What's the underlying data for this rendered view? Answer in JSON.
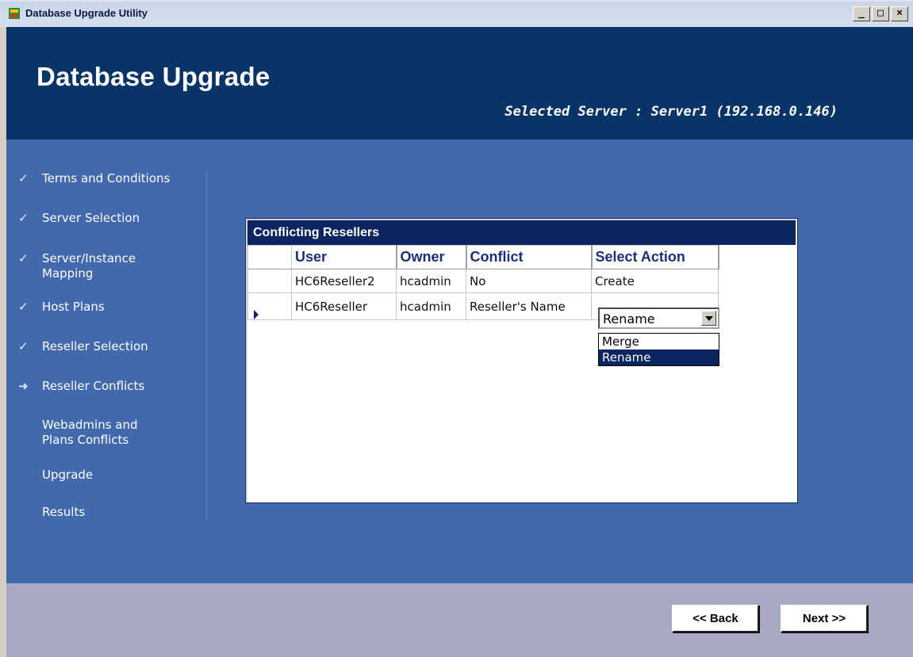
{
  "window": {
    "title": "Database Upgrade Utility",
    "controls": {
      "minimize": "_",
      "maximize": "□",
      "close": "×"
    }
  },
  "header": {
    "title": "Database Upgrade",
    "server_text": "Selected Server : Server1 (192.168.0.146)"
  },
  "nav": {
    "items": [
      {
        "label": "Terms and Conditions",
        "mark": "✓",
        "state": "done"
      },
      {
        "label": "Server Selection",
        "mark": "✓",
        "state": "done"
      },
      {
        "label": "Server/Instance Mapping",
        "mark": "✓",
        "state": "done"
      },
      {
        "label": "Host Plans",
        "mark": "✓",
        "state": "done"
      },
      {
        "label": "Reseller Selection",
        "mark": "✓",
        "state": "done"
      },
      {
        "label": "Reseller Conflicts",
        "mark": "➜",
        "state": "current"
      },
      {
        "label": "Webadmins and Plans Conflicts",
        "mark": "",
        "state": "pending"
      },
      {
        "label": "Upgrade",
        "mark": "",
        "state": "pending"
      },
      {
        "label": "Results",
        "mark": "",
        "state": "pending"
      }
    ]
  },
  "grid": {
    "caption": "Conflicting Resellers",
    "columns": [
      "User",
      "Owner",
      "Conflict",
      "Select Action"
    ],
    "rows": [
      {
        "user": "HC6Reseller2",
        "owner": "hcadmin",
        "conflict": "No",
        "action": "Create"
      },
      {
        "user": "HC6Reseller",
        "owner": "hcadmin",
        "conflict": "Reseller's Name",
        "action": "Rename"
      }
    ],
    "dropdown": {
      "selected": "Rename",
      "options": [
        "Merge",
        "Rename"
      ],
      "highlighted": "Rename"
    }
  },
  "footer": {
    "back_label": "<< Back",
    "next_label": "Next >>"
  },
  "colors": {
    "header_bg": "#093467",
    "body_bg": "#4268ae",
    "caption_bg": "#0b2562",
    "footer_bg": "#a7a9c3"
  }
}
